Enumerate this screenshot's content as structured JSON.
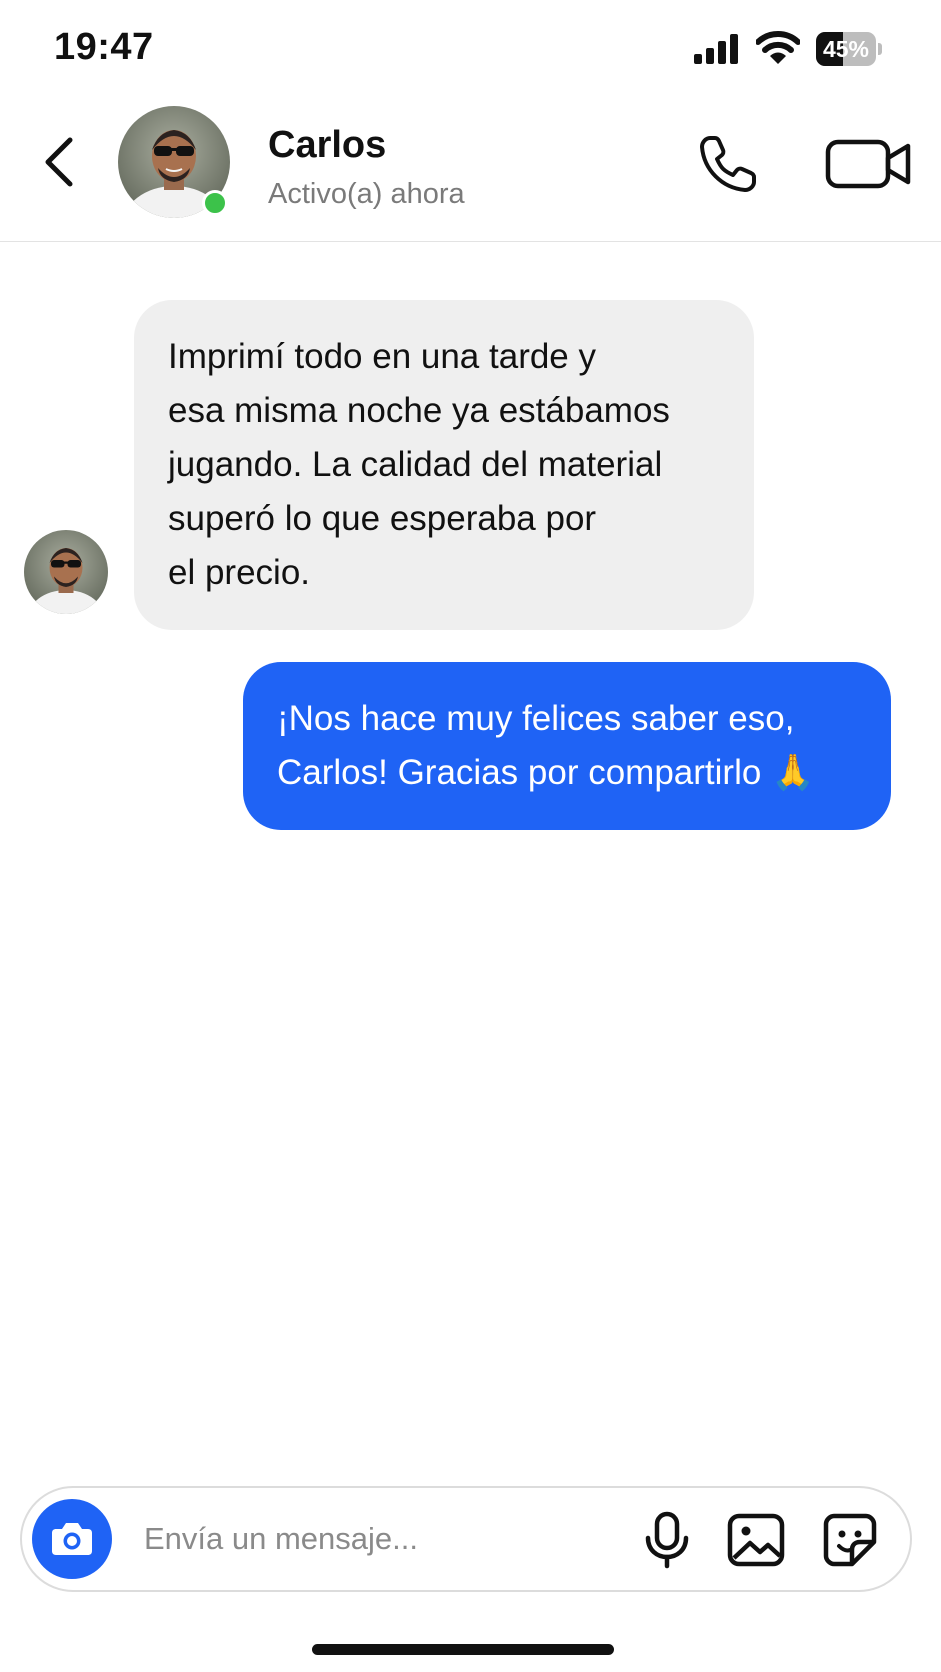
{
  "status_bar": {
    "time": "19:47",
    "battery_percent": 45,
    "battery_label": "45%",
    "signal_icon": "cellular-signal-icon",
    "wifi_icon": "wifi-icon"
  },
  "header": {
    "back_icon": "chevron-left-icon",
    "contact_name": "Carlos",
    "contact_status": "Activo(a) ahora",
    "online": true,
    "call_icon": "phone-icon",
    "video_icon": "video-camera-icon"
  },
  "messages": [
    {
      "direction": "incoming",
      "lines": [
        "Imprimí todo en una tarde y",
        "esa misma noche ya estábamos",
        "jugando. La calidad del material",
        "superó lo que esperaba por",
        "el precio."
      ]
    },
    {
      "direction": "outgoing",
      "lines": [
        "¡Nos hace muy felices saber eso,",
        "Carlos! Gracias por compartirlo 🙏"
      ]
    }
  ],
  "composer": {
    "placeholder": "Envía un mensaje...",
    "value": "",
    "camera_icon": "camera-icon",
    "mic_icon": "microphone-icon",
    "image_icon": "image-gallery-icon",
    "sticker_icon": "sticker-icon"
  },
  "colors": {
    "accent": "#1f63f5",
    "incoming_bubble": "#efefef",
    "online_dot": "#3cc24a",
    "secondary_text": "#7a7a7a"
  }
}
